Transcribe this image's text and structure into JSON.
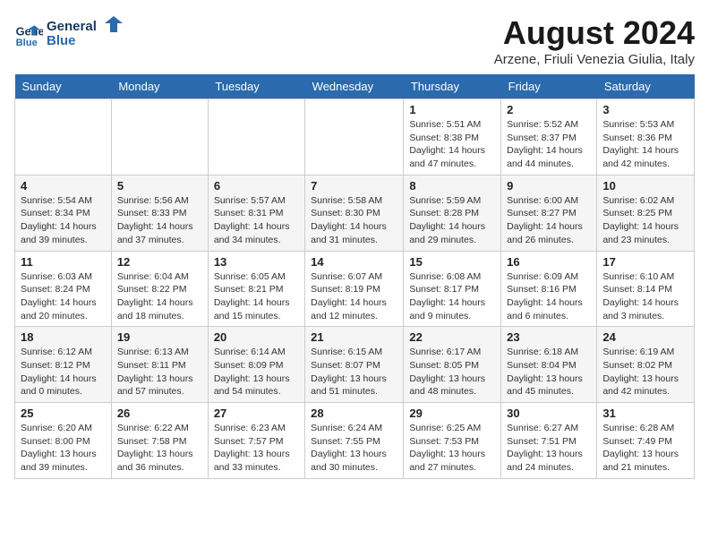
{
  "logo": {
    "line1": "General",
    "line2": "Blue"
  },
  "title": "August 2024",
  "subtitle": "Arzene, Friuli Venezia Giulia, Italy",
  "weekdays": [
    "Sunday",
    "Monday",
    "Tuesday",
    "Wednesday",
    "Thursday",
    "Friday",
    "Saturday"
  ],
  "weeks": [
    [
      {
        "day": "",
        "info": ""
      },
      {
        "day": "",
        "info": ""
      },
      {
        "day": "",
        "info": ""
      },
      {
        "day": "",
        "info": ""
      },
      {
        "day": "1",
        "info": "Sunrise: 5:51 AM\nSunset: 8:38 PM\nDaylight: 14 hours and 47 minutes."
      },
      {
        "day": "2",
        "info": "Sunrise: 5:52 AM\nSunset: 8:37 PM\nDaylight: 14 hours and 44 minutes."
      },
      {
        "day": "3",
        "info": "Sunrise: 5:53 AM\nSunset: 8:36 PM\nDaylight: 14 hours and 42 minutes."
      }
    ],
    [
      {
        "day": "4",
        "info": "Sunrise: 5:54 AM\nSunset: 8:34 PM\nDaylight: 14 hours and 39 minutes."
      },
      {
        "day": "5",
        "info": "Sunrise: 5:56 AM\nSunset: 8:33 PM\nDaylight: 14 hours and 37 minutes."
      },
      {
        "day": "6",
        "info": "Sunrise: 5:57 AM\nSunset: 8:31 PM\nDaylight: 14 hours and 34 minutes."
      },
      {
        "day": "7",
        "info": "Sunrise: 5:58 AM\nSunset: 8:30 PM\nDaylight: 14 hours and 31 minutes."
      },
      {
        "day": "8",
        "info": "Sunrise: 5:59 AM\nSunset: 8:28 PM\nDaylight: 14 hours and 29 minutes."
      },
      {
        "day": "9",
        "info": "Sunrise: 6:00 AM\nSunset: 8:27 PM\nDaylight: 14 hours and 26 minutes."
      },
      {
        "day": "10",
        "info": "Sunrise: 6:02 AM\nSunset: 8:25 PM\nDaylight: 14 hours and 23 minutes."
      }
    ],
    [
      {
        "day": "11",
        "info": "Sunrise: 6:03 AM\nSunset: 8:24 PM\nDaylight: 14 hours and 20 minutes."
      },
      {
        "day": "12",
        "info": "Sunrise: 6:04 AM\nSunset: 8:22 PM\nDaylight: 14 hours and 18 minutes."
      },
      {
        "day": "13",
        "info": "Sunrise: 6:05 AM\nSunset: 8:21 PM\nDaylight: 14 hours and 15 minutes."
      },
      {
        "day": "14",
        "info": "Sunrise: 6:07 AM\nSunset: 8:19 PM\nDaylight: 14 hours and 12 minutes."
      },
      {
        "day": "15",
        "info": "Sunrise: 6:08 AM\nSunset: 8:17 PM\nDaylight: 14 hours and 9 minutes."
      },
      {
        "day": "16",
        "info": "Sunrise: 6:09 AM\nSunset: 8:16 PM\nDaylight: 14 hours and 6 minutes."
      },
      {
        "day": "17",
        "info": "Sunrise: 6:10 AM\nSunset: 8:14 PM\nDaylight: 14 hours and 3 minutes."
      }
    ],
    [
      {
        "day": "18",
        "info": "Sunrise: 6:12 AM\nSunset: 8:12 PM\nDaylight: 14 hours and 0 minutes."
      },
      {
        "day": "19",
        "info": "Sunrise: 6:13 AM\nSunset: 8:11 PM\nDaylight: 13 hours and 57 minutes."
      },
      {
        "day": "20",
        "info": "Sunrise: 6:14 AM\nSunset: 8:09 PM\nDaylight: 13 hours and 54 minutes."
      },
      {
        "day": "21",
        "info": "Sunrise: 6:15 AM\nSunset: 8:07 PM\nDaylight: 13 hours and 51 minutes."
      },
      {
        "day": "22",
        "info": "Sunrise: 6:17 AM\nSunset: 8:05 PM\nDaylight: 13 hours and 48 minutes."
      },
      {
        "day": "23",
        "info": "Sunrise: 6:18 AM\nSunset: 8:04 PM\nDaylight: 13 hours and 45 minutes."
      },
      {
        "day": "24",
        "info": "Sunrise: 6:19 AM\nSunset: 8:02 PM\nDaylight: 13 hours and 42 minutes."
      }
    ],
    [
      {
        "day": "25",
        "info": "Sunrise: 6:20 AM\nSunset: 8:00 PM\nDaylight: 13 hours and 39 minutes."
      },
      {
        "day": "26",
        "info": "Sunrise: 6:22 AM\nSunset: 7:58 PM\nDaylight: 13 hours and 36 minutes."
      },
      {
        "day": "27",
        "info": "Sunrise: 6:23 AM\nSunset: 7:57 PM\nDaylight: 13 hours and 33 minutes."
      },
      {
        "day": "28",
        "info": "Sunrise: 6:24 AM\nSunset: 7:55 PM\nDaylight: 13 hours and 30 minutes."
      },
      {
        "day": "29",
        "info": "Sunrise: 6:25 AM\nSunset: 7:53 PM\nDaylight: 13 hours and 27 minutes."
      },
      {
        "day": "30",
        "info": "Sunrise: 6:27 AM\nSunset: 7:51 PM\nDaylight: 13 hours and 24 minutes."
      },
      {
        "day": "31",
        "info": "Sunrise: 6:28 AM\nSunset: 7:49 PM\nDaylight: 13 hours and 21 minutes."
      }
    ]
  ]
}
